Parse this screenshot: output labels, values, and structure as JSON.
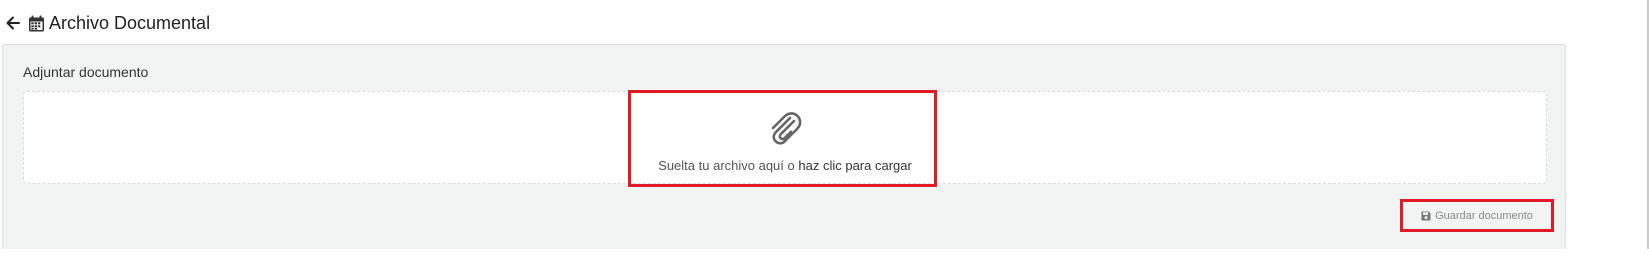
{
  "header": {
    "title": "Archivo Documental"
  },
  "upload": {
    "label": "Adjuntar documento",
    "drop_text": "Suelta tu archivo aquí o",
    "drop_link": "haz clic para cargar"
  },
  "actions": {
    "save_label": "Guardar documento"
  },
  "icons": {
    "back": "arrow-left-icon",
    "title": "calendar-icon",
    "dropzone": "paperclip-icon",
    "save": "floppy-disk-icon"
  },
  "colors": {
    "highlight": "#e01b25",
    "panel_bg": "#f2f3f3"
  }
}
